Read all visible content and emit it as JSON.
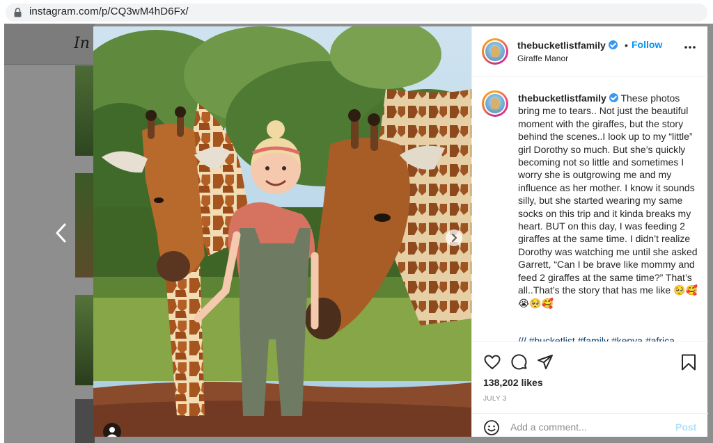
{
  "browser": {
    "url": "instagram.com/p/CQ3wM4hD6Fx/"
  },
  "background": {
    "logo_text": "In"
  },
  "post": {
    "author": "thebucketlistfamily",
    "dot": "•",
    "follow_label": "Follow",
    "location": "Giraffe Manor",
    "caption_author": "thebucketlistfamily",
    "caption_text": "These photos bring me to tears.. Not just the beautiful moment with the giraffes, but the story behind the scenes..I look up to my “little” girl Dorothy so much. But she’s quickly becoming not so little and sometimes I worry she is outgrowing me and my influence as her mother. I know it sounds silly, but she started wearing my same socks on this trip and it kinda breaks my heart. BUT on this day, I was feeding 2 giraffes at the same time. I didn’t realize Dorothy was watching me until she asked Garrett, “Can I be brave like mommy and feed 2 giraffes at the same time?” That’s all..That’s the story that has me like 🥺🥰😭🥺🥰",
    "hashtags": "/// #bucketlist #family #kenya #africa",
    "likes": "138,202 likes",
    "date": "JULY 3",
    "comment_placeholder": "Add a comment...",
    "post_label": "Post"
  },
  "icons": {
    "lock": "lock-icon",
    "more": "more-options-icon",
    "like": "heart-icon",
    "comment": "comment-icon",
    "share": "share-icon",
    "save": "bookmark-icon",
    "emoji": "emoji-icon",
    "prev": "chevron-left-icon",
    "next": "chevron-right-icon",
    "tag": "user-tag-icon"
  },
  "colors": {
    "link_blue": "#0095f6",
    "verified_blue": "#3897f0",
    "post_disabled": "#b2dffc",
    "overlay_gray": "#8e8e8e"
  }
}
